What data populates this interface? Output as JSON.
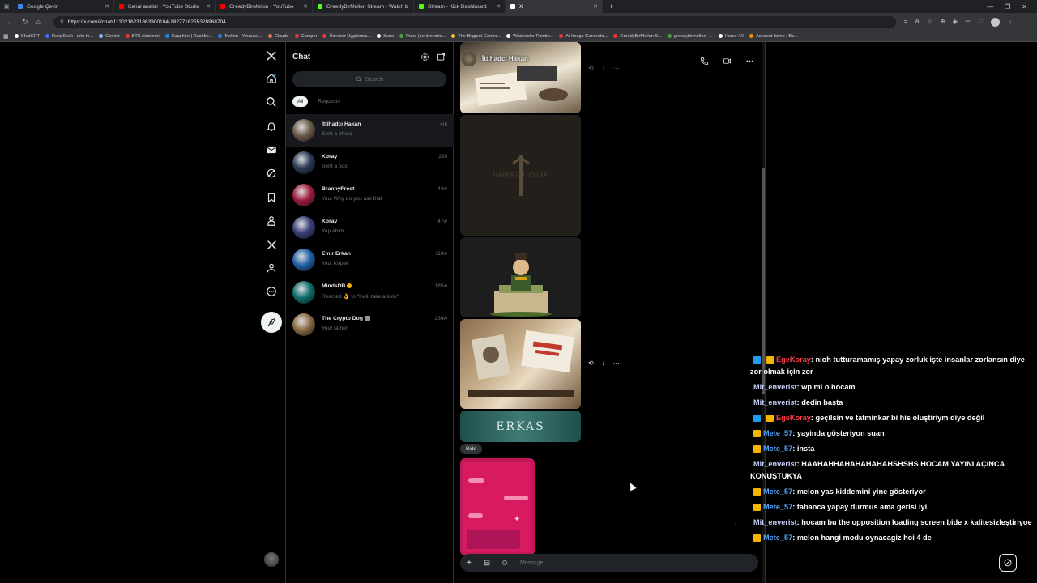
{
  "browser": {
    "tabs": [
      {
        "label": "Google Çeviri",
        "color": "#4285f4"
      },
      {
        "label": "Kanal analizi - YouTube Studio",
        "color": "#ff0000"
      },
      {
        "label": "GreedyBirMellon - YouTube",
        "color": "#ff0000"
      },
      {
        "label": "GreedyBirMellon Stream - Watch L",
        "color": "#53fc18"
      },
      {
        "label": "Stream - Kick Dashboard",
        "color": "#53fc18"
      },
      {
        "label": "X",
        "color": "#ffffff"
      }
    ],
    "new_tab": "+",
    "url": "https://x.com/i/chat/1130216231863300104-1827716255328968704",
    "bookmarks": [
      {
        "label": "ChatGPT",
        "color": "#ffffff"
      },
      {
        "label": "DeepSeek - into th...",
        "color": "#4d6bfe"
      },
      {
        "label": "Gemini",
        "color": "#8ab4f8"
      },
      {
        "label": "BTK Akademi",
        "color": "#e53935"
      },
      {
        "label": "Sapphire | Dashbo...",
        "color": "#1e88e5"
      },
      {
        "label": "Mellon - Youtube...",
        "color": "#1e88e5"
      },
      {
        "label": "Claude",
        "color": "#d97757"
      },
      {
        "label": "Camper",
        "color": "#e53935"
      },
      {
        "label": "Ücretsiz Uygulama...",
        "color": "#e53935"
      },
      {
        "label": "Suno",
        "color": "#ffffff"
      },
      {
        "label": "Pano (bentrendim...",
        "color": "#43a047"
      },
      {
        "label": "The Biggest Gamer...",
        "color": "#fbc02d"
      },
      {
        "label": "Watercolor Paintin...",
        "color": "#ffffff"
      },
      {
        "label": "AI Image Generato...",
        "color": "#e53935"
      },
      {
        "label": "GreedyBirMellon S...",
        "color": "#e53935"
      },
      {
        "label": "greedybirmellon -...",
        "color": "#43a047"
      },
      {
        "label": "Home / X",
        "color": "#ffffff"
      },
      {
        "label": "Account home | Ba...",
        "color": "#fb8c00"
      }
    ]
  },
  "chat_list": {
    "title": "Chat",
    "search_placeholder": "Search",
    "filters": [
      "All",
      "Requests"
    ],
    "conversations": [
      {
        "name": "İttihadcı Hakan",
        "preview": "Sent a photo",
        "time": "4m",
        "avatar_color": "#6b5b4a"
      },
      {
        "name": "Koray",
        "preview": "Sent a post",
        "time": "22h",
        "avatar_color": "#2b3a55"
      },
      {
        "name": "BrannyFrost",
        "preview": "You: Why do you ask that",
        "time": "44w",
        "avatar_color": "#a01b3e"
      },
      {
        "name": "Koray",
        "preview": "Yap abim",
        "time": "47w",
        "avatar_color": "#3a3f7a"
      },
      {
        "name": "Emir Erkan",
        "preview": "You: Kopek",
        "time": "110w",
        "avatar_color": "#1f5fa8"
      },
      {
        "name": "MindsDB",
        "preview": "Reacted 👌 to \"I will take a look\"",
        "time": "185w",
        "avatar_color": "#0f6e6e"
      },
      {
        "name": "The Crypto Dog",
        "preview": "Your father",
        "time": "236w",
        "avatar_color": "#8a6a42"
      }
    ]
  },
  "conversation": {
    "contact_name": "İttihadcı Hakan",
    "image_caption": "Bide",
    "embossed_text": "IMPERIAL CORE",
    "logo_text": "ERKAS",
    "input_placeholder": "Message"
  },
  "stream_chat": [
    {
      "user": "EgeKoray",
      "user_color": "#ff3b4a",
      "badges": [
        "#1d9bf0",
        "#f4b400"
      ],
      "text": ": nioh tutturamamış yapay zorluk işte insanlar zorlansın diye zor olmak için zor"
    },
    {
      "user": "Mit_enverist",
      "user_color": "#c8d4ff",
      "badges": [],
      "text": ": wp mi o hocam"
    },
    {
      "user": "Mit_enverist",
      "user_color": "#c8d4ff",
      "badges": [],
      "text": ": dedin başta"
    },
    {
      "user": "EgeKoray",
      "user_color": "#ff3b4a",
      "badges": [
        "#1d9bf0",
        "#f4b400"
      ],
      "text": ": geçilsin ve tatminkar bi his oluştiriym diye değil"
    },
    {
      "user": "Mete_57",
      "user_color": "#55a7ff",
      "badges": [
        "#f4b400"
      ],
      "text": ": yayinda gösteriyon suan"
    },
    {
      "user": "Mete_57",
      "user_color": "#55a7ff",
      "badges": [
        "#f4b400"
      ],
      "text": ": insta"
    },
    {
      "user": "Mit_enverist",
      "user_color": "#c8d4ff",
      "badges": [],
      "text": ": HAAHAHHAHAHAHAHAHSHSHS HOCAM YAYINI AÇINCA KONUŞTUKYA"
    },
    {
      "user": "Mete_57",
      "user_color": "#55a7ff",
      "badges": [
        "#f4b400"
      ],
      "text": ": melon yas kiddemini yine gösteriyor"
    },
    {
      "user": "Mete_57",
      "user_color": "#55a7ff",
      "badges": [
        "#f4b400"
      ],
      "text": ": tabanca yapay durmus ama gerisi iyi"
    },
    {
      "user": "Mit_enverist",
      "user_color": "#c8d4ff",
      "badges": [],
      "text": ": hocam bu the opposition loading screen bide x kalitesizleştiriyoe"
    },
    {
      "user": "Mete_57",
      "user_color": "#55a7ff",
      "badges": [
        "#f4b400"
      ],
      "text": ": melon hangi modu oynacagiz hoi 4 de"
    }
  ]
}
